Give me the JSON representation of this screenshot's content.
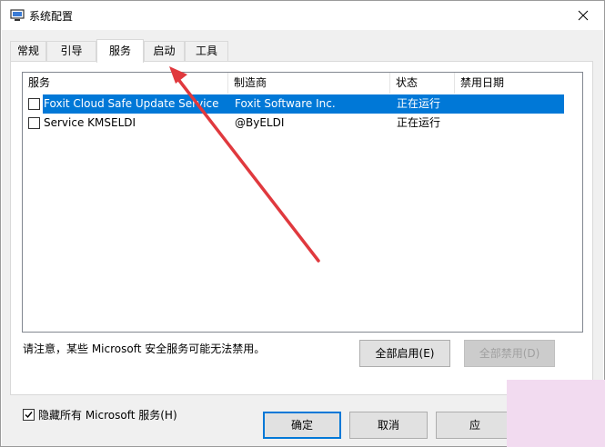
{
  "window": {
    "title": "系统配置"
  },
  "tabs": [
    {
      "label": "常规"
    },
    {
      "label": "引导"
    },
    {
      "label": "服务"
    },
    {
      "label": "启动"
    },
    {
      "label": "工具"
    }
  ],
  "active_tab": "服务",
  "columns": [
    "服务",
    "制造商",
    "状态",
    "禁用日期"
  ],
  "rows": [
    {
      "name": "Foxit Cloud Safe Update Service",
      "maker": "Foxit Software Inc.",
      "status": "正在运行",
      "disabled_date": "",
      "checked": false,
      "selected": true
    },
    {
      "name": "Service KMSELDI",
      "maker": "@ByELDI",
      "status": "正在运行",
      "disabled_date": "",
      "checked": false,
      "selected": false
    }
  ],
  "note": "请注意，某些 Microsoft 安全服务可能无法禁用。",
  "buttons": {
    "enable_all": "全部启用(E)",
    "disable_all": "全部禁用(D)",
    "ok": "确定",
    "cancel": "取消",
    "apply": "应"
  },
  "hide_ms": {
    "label": "隐藏所有 Microsoft 服务(H)",
    "checked": true
  },
  "colors": {
    "selection": "#0078d7",
    "arrow": "#e0393e",
    "corner_deco": "#f2dbf0"
  }
}
